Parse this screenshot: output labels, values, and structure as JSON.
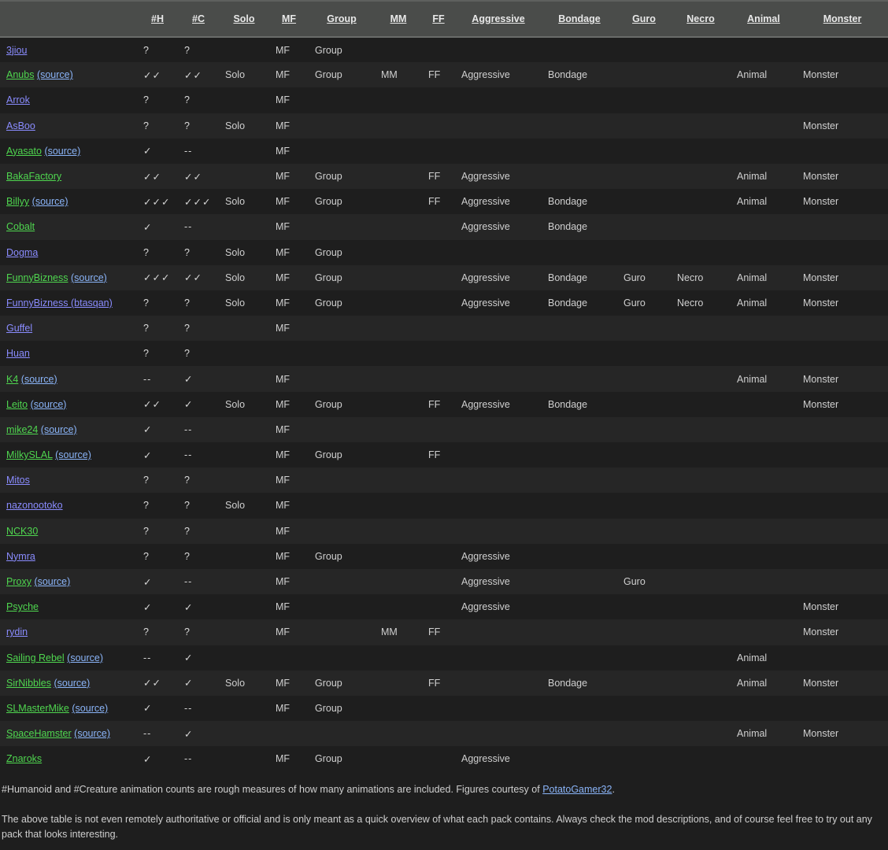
{
  "table": {
    "headers": [
      "",
      "#H",
      "#C",
      "Solo",
      "MF",
      "Group",
      "MM",
      "FF",
      "Aggressive",
      "Bondage",
      "Guro",
      "Necro",
      "Animal",
      "Monster"
    ],
    "rows": [
      {
        "name": "3jiou",
        "link_color": "blue",
        "source": "",
        "h": "?",
        "c": "?",
        "solo": "",
        "mf": "MF",
        "group": "Group",
        "mm": "",
        "ff": "",
        "aggressive": "",
        "bondage": "",
        "guro": "",
        "necro": "",
        "animal": "",
        "monster": ""
      },
      {
        "name": "Anubs",
        "link_color": "green",
        "source": "(source)",
        "h": "✓✓",
        "c": "✓✓",
        "solo": "Solo",
        "mf": "MF",
        "group": "Group",
        "mm": "MM",
        "ff": "FF",
        "aggressive": "Aggressive",
        "bondage": "Bondage",
        "guro": "",
        "necro": "",
        "animal": "Animal",
        "monster": "Monster"
      },
      {
        "name": "Arrok",
        "link_color": "blue",
        "source": "",
        "h": "?",
        "c": "?",
        "solo": "",
        "mf": "MF",
        "group": "",
        "mm": "",
        "ff": "",
        "aggressive": "",
        "bondage": "",
        "guro": "",
        "necro": "",
        "animal": "",
        "monster": ""
      },
      {
        "name": "AsBoo",
        "link_color": "blue",
        "source": "",
        "h": "?",
        "c": "?",
        "solo": "Solo",
        "mf": "MF",
        "group": "",
        "mm": "",
        "ff": "",
        "aggressive": "",
        "bondage": "",
        "guro": "",
        "necro": "",
        "animal": "",
        "monster": "Monster"
      },
      {
        "name": "Ayasato",
        "link_color": "green",
        "source": "(source)",
        "h": "✓",
        "c": "--",
        "solo": "",
        "mf": "MF",
        "group": "",
        "mm": "",
        "ff": "",
        "aggressive": "",
        "bondage": "",
        "guro": "",
        "necro": "",
        "animal": "",
        "monster": ""
      },
      {
        "name": "BakaFactory",
        "link_color": "green",
        "source": "",
        "h": "✓✓",
        "c": "✓✓",
        "solo": "",
        "mf": "MF",
        "group": "Group",
        "mm": "",
        "ff": "FF",
        "aggressive": "Aggressive",
        "bondage": "",
        "guro": "",
        "necro": "",
        "animal": "Animal",
        "monster": "Monster"
      },
      {
        "name": "Billyy",
        "link_color": "green",
        "source": "(source)",
        "h": "✓✓✓",
        "c": "✓✓✓",
        "solo": "Solo",
        "mf": "MF",
        "group": "Group",
        "mm": "",
        "ff": "FF",
        "aggressive": "Aggressive",
        "bondage": "Bondage",
        "guro": "",
        "necro": "",
        "animal": "Animal",
        "monster": "Monster"
      },
      {
        "name": "Cobalt",
        "link_color": "green",
        "source": "",
        "h": "✓",
        "c": "--",
        "solo": "",
        "mf": "MF",
        "group": "",
        "mm": "",
        "ff": "",
        "aggressive": "Aggressive",
        "bondage": "Bondage",
        "guro": "",
        "necro": "",
        "animal": "",
        "monster": ""
      },
      {
        "name": "Dogma",
        "link_color": "blue",
        "source": "",
        "h": "?",
        "c": "?",
        "solo": "Solo",
        "mf": "MF",
        "group": "Group",
        "mm": "",
        "ff": "",
        "aggressive": "",
        "bondage": "",
        "guro": "",
        "necro": "",
        "animal": "",
        "monster": ""
      },
      {
        "name": "FunnyBizness",
        "link_color": "green",
        "source": "(source)",
        "h": "✓✓✓",
        "c": "✓✓",
        "solo": "Solo",
        "mf": "MF",
        "group": "Group",
        "mm": "",
        "ff": "",
        "aggressive": "Aggressive",
        "bondage": "Bondage",
        "guro": "Guro",
        "necro": "Necro",
        "animal": "Animal",
        "monster": "Monster"
      },
      {
        "name": "FunnyBizness (btasqan)",
        "link_color": "blue",
        "source": "",
        "h": "?",
        "c": "?",
        "solo": "Solo",
        "mf": "MF",
        "group": "Group",
        "mm": "",
        "ff": "",
        "aggressive": "Aggressive",
        "bondage": "Bondage",
        "guro": "Guro",
        "necro": "Necro",
        "animal": "Animal",
        "monster": "Monster"
      },
      {
        "name": "Guffel",
        "link_color": "blue",
        "source": "",
        "h": "?",
        "c": "?",
        "solo": "",
        "mf": "MF",
        "group": "",
        "mm": "",
        "ff": "",
        "aggressive": "",
        "bondage": "",
        "guro": "",
        "necro": "",
        "animal": "",
        "monster": ""
      },
      {
        "name": "Huan",
        "link_color": "blue",
        "source": "",
        "h": "?",
        "c": "?",
        "solo": "",
        "mf": "",
        "group": "",
        "mm": "",
        "ff": "",
        "aggressive": "",
        "bondage": "",
        "guro": "",
        "necro": "",
        "animal": "",
        "monster": ""
      },
      {
        "name": "K4",
        "link_color": "green",
        "source": "(source)",
        "h": "--",
        "c": "✓",
        "solo": "",
        "mf": "MF",
        "group": "",
        "mm": "",
        "ff": "",
        "aggressive": "",
        "bondage": "",
        "guro": "",
        "necro": "",
        "animal": "Animal",
        "monster": "Monster"
      },
      {
        "name": "Leito",
        "link_color": "green",
        "source": "(source)",
        "h": "✓✓",
        "c": "✓",
        "solo": "Solo",
        "mf": "MF",
        "group": "Group",
        "mm": "",
        "ff": "FF",
        "aggressive": "Aggressive",
        "bondage": "Bondage",
        "guro": "",
        "necro": "",
        "animal": "",
        "monster": "Monster"
      },
      {
        "name": "mike24",
        "link_color": "green",
        "source": "(source)",
        "h": "✓",
        "c": "--",
        "solo": "",
        "mf": "MF",
        "group": "",
        "mm": "",
        "ff": "",
        "aggressive": "",
        "bondage": "",
        "guro": "",
        "necro": "",
        "animal": "",
        "monster": ""
      },
      {
        "name": "MilkySLAL",
        "link_color": "green",
        "source": "(source)",
        "h": "✓",
        "c": "--",
        "solo": "",
        "mf": "MF",
        "group": "Group",
        "mm": "",
        "ff": "FF",
        "aggressive": "",
        "bondage": "",
        "guro": "",
        "necro": "",
        "animal": "",
        "monster": ""
      },
      {
        "name": "Mitos",
        "link_color": "blue",
        "source": "",
        "h": "?",
        "c": "?",
        "solo": "",
        "mf": "MF",
        "group": "",
        "mm": "",
        "ff": "",
        "aggressive": "",
        "bondage": "",
        "guro": "",
        "necro": "",
        "animal": "",
        "monster": ""
      },
      {
        "name": "nazonootoko",
        "link_color": "blue",
        "source": "",
        "h": "?",
        "c": "?",
        "solo": "Solo",
        "mf": "MF",
        "group": "",
        "mm": "",
        "ff": "",
        "aggressive": "",
        "bondage": "",
        "guro": "",
        "necro": "",
        "animal": "",
        "monster": ""
      },
      {
        "name": "NCK30",
        "link_color": "green",
        "source": "",
        "h": "?",
        "c": "?",
        "solo": "",
        "mf": "MF",
        "group": "",
        "mm": "",
        "ff": "",
        "aggressive": "",
        "bondage": "",
        "guro": "",
        "necro": "",
        "animal": "",
        "monster": ""
      },
      {
        "name": "Nymra",
        "link_color": "blue",
        "source": "",
        "h": "?",
        "c": "?",
        "solo": "",
        "mf": "MF",
        "group": "Group",
        "mm": "",
        "ff": "",
        "aggressive": "Aggressive",
        "bondage": "",
        "guro": "",
        "necro": "",
        "animal": "",
        "monster": ""
      },
      {
        "name": "Proxy",
        "link_color": "green",
        "source": "(source)",
        "h": "✓",
        "c": "--",
        "solo": "",
        "mf": "MF",
        "group": "",
        "mm": "",
        "ff": "",
        "aggressive": "Aggressive",
        "bondage": "",
        "guro": "Guro",
        "necro": "",
        "animal": "",
        "monster": ""
      },
      {
        "name": "Psyche",
        "link_color": "green",
        "source": "",
        "h": "✓",
        "c": "✓",
        "solo": "",
        "mf": "MF",
        "group": "",
        "mm": "",
        "ff": "",
        "aggressive": "Aggressive",
        "bondage": "",
        "guro": "",
        "necro": "",
        "animal": "",
        "monster": "Monster"
      },
      {
        "name": "rydin",
        "link_color": "blue",
        "source": "",
        "h": "?",
        "c": "?",
        "solo": "",
        "mf": "MF",
        "group": "",
        "mm": "MM",
        "ff": "FF",
        "aggressive": "",
        "bondage": "",
        "guro": "",
        "necro": "",
        "animal": "",
        "monster": "Monster"
      },
      {
        "name": "Sailing Rebel",
        "link_color": "green",
        "source": "(source)",
        "h": "--",
        "c": "✓",
        "solo": "",
        "mf": "",
        "group": "",
        "mm": "",
        "ff": "",
        "aggressive": "",
        "bondage": "",
        "guro": "",
        "necro": "",
        "animal": "Animal",
        "monster": ""
      },
      {
        "name": "SirNibbles",
        "link_color": "green",
        "source": "(source)",
        "h": "✓✓",
        "c": "✓",
        "solo": "Solo",
        "mf": "MF",
        "group": "Group",
        "mm": "",
        "ff": "FF",
        "aggressive": "",
        "bondage": "Bondage",
        "guro": "",
        "necro": "",
        "animal": "Animal",
        "monster": "Monster"
      },
      {
        "name": "SLMasterMike",
        "link_color": "green",
        "source": "(source)",
        "h": "✓",
        "c": "--",
        "solo": "",
        "mf": "MF",
        "group": "Group",
        "mm": "",
        "ff": "",
        "aggressive": "",
        "bondage": "",
        "guro": "",
        "necro": "",
        "animal": "",
        "monster": ""
      },
      {
        "name": "SpaceHamster",
        "link_color": "green",
        "source": "(source)",
        "h": "--",
        "c": "✓",
        "solo": "",
        "mf": "",
        "group": "",
        "mm": "",
        "ff": "",
        "aggressive": "",
        "bondage": "",
        "guro": "",
        "necro": "",
        "animal": "Animal",
        "monster": "Monster"
      },
      {
        "name": "Znaroks",
        "link_color": "green",
        "source": "",
        "h": "✓",
        "c": "--",
        "solo": "",
        "mf": "MF",
        "group": "Group",
        "mm": "",
        "ff": "",
        "aggressive": "Aggressive",
        "bondage": "",
        "guro": "",
        "necro": "",
        "animal": "",
        "monster": ""
      }
    ]
  },
  "notes": {
    "note1_text": "#Humanoid and #Creature animation counts are rough measures of how many animations are included. Figures courtesy of ",
    "note1_link": "PotatoGamer32",
    "note1_end": ".",
    "note2_text": "The above table is not even remotely authoritative or official and is only meant as a quick overview of what each pack contains. Always check the mod descriptions, and of course feel free to try out any pack that looks interesting."
  },
  "colors": {
    "background": "#1e1e1e",
    "row_alt": "#262626",
    "header_bg": "#4a4c4a",
    "link_green": "#4fd64f",
    "link_blue": "#8a8cff",
    "link_source": "#8ab4f8"
  }
}
